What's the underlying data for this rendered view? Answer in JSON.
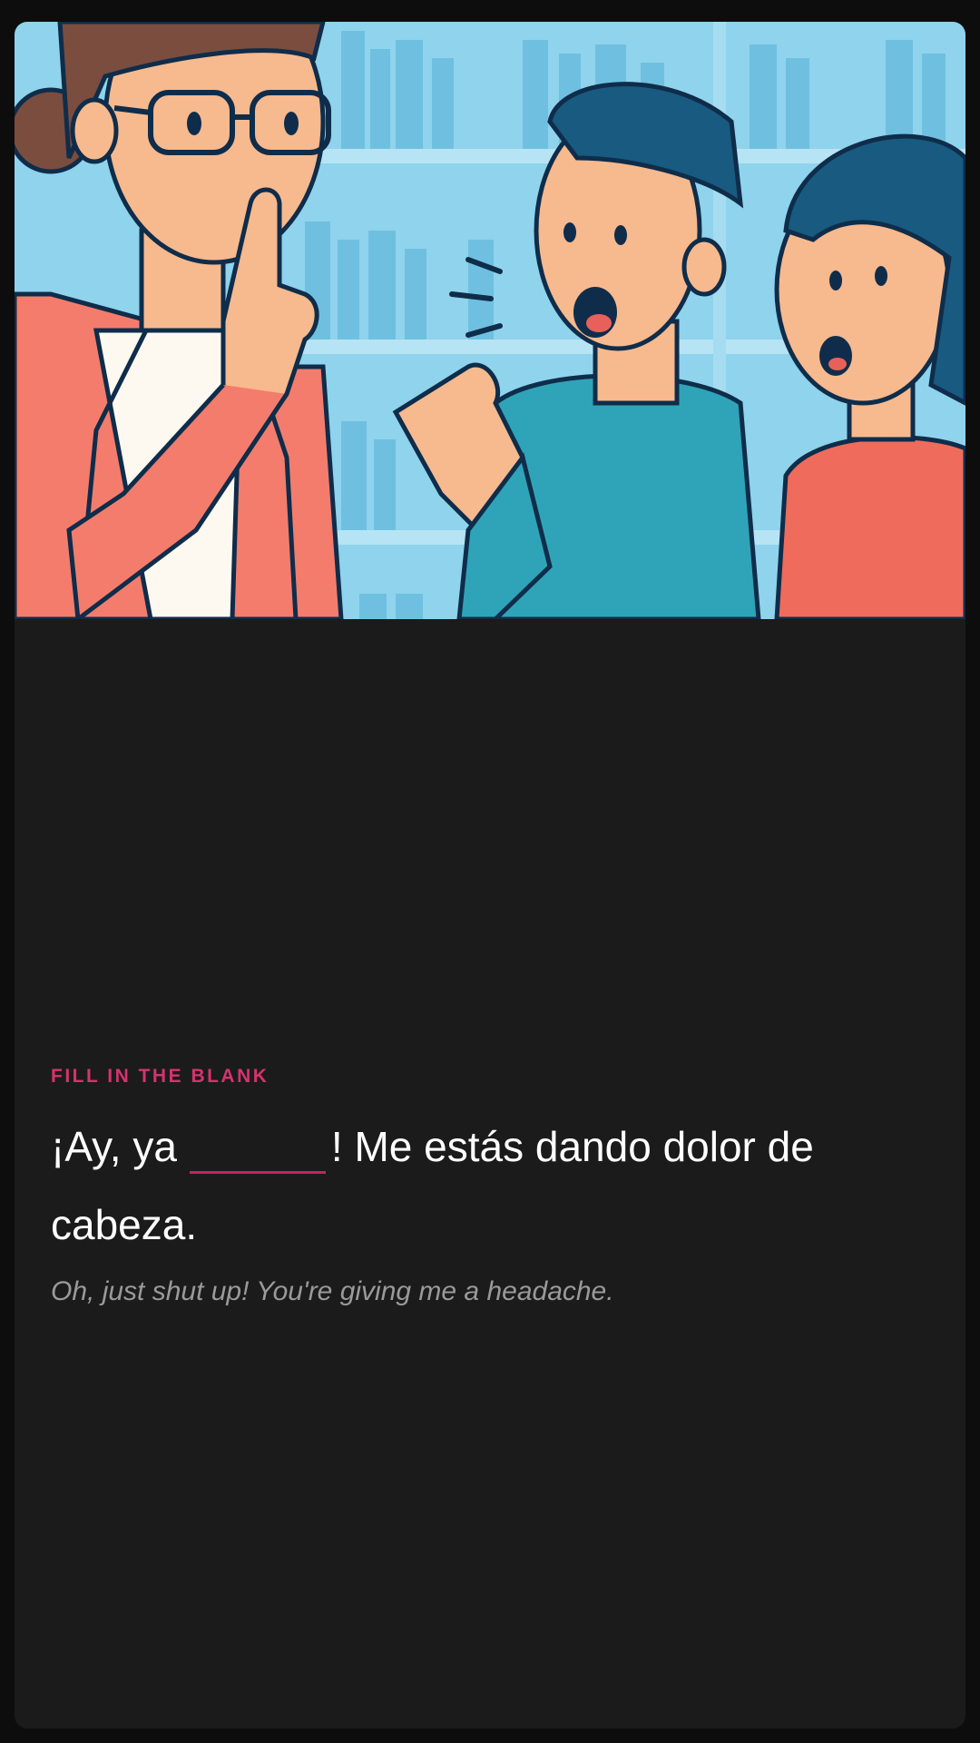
{
  "exercise": {
    "label": "FILL IN THE BLANK",
    "sentence_before": "¡Ay, ya",
    "sentence_after": "! Me estás dando dolor de cabeza.",
    "translation": "Oh, just shut up! You're giving me a headache."
  },
  "illustration": {
    "description_icon": "librarian-shushing-students-illustration"
  },
  "colors": {
    "accent": "#d6336c",
    "background": "#1b1b1b",
    "sky": "#8fd3ec"
  }
}
